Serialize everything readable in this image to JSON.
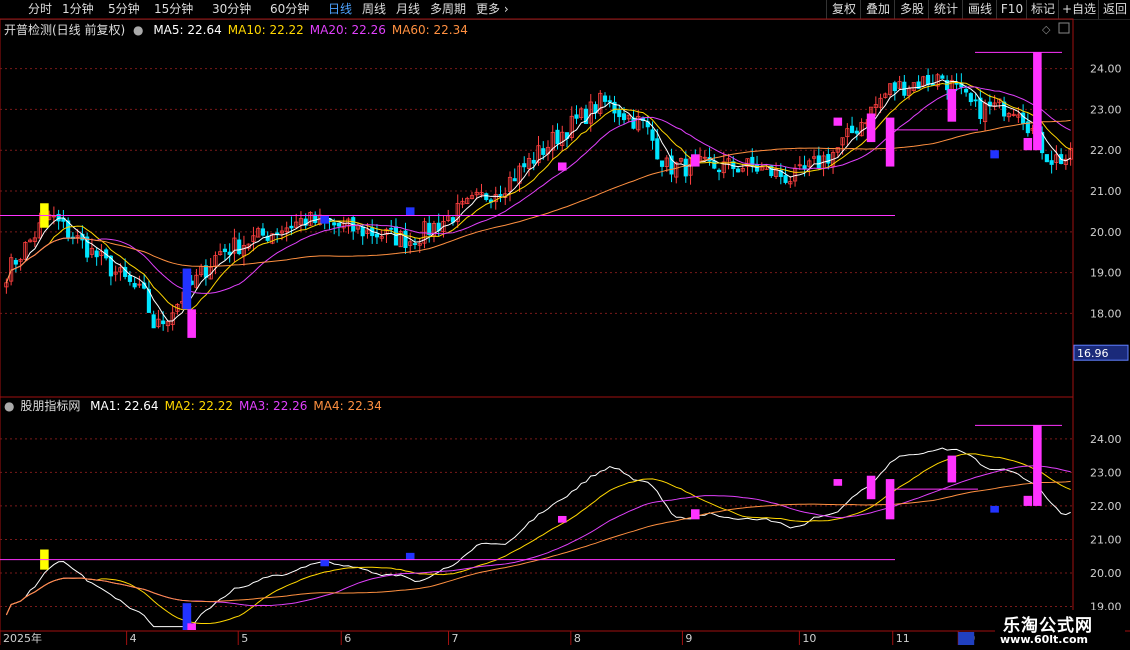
{
  "toolbar": {
    "periods": [
      {
        "label": "分时",
        "active": false
      },
      {
        "label": "1分钟",
        "active": false
      },
      {
        "label": "5分钟",
        "active": false
      },
      {
        "label": "15分钟",
        "active": false
      },
      {
        "label": "30分钟",
        "active": false
      },
      {
        "label": "60分钟",
        "active": false
      },
      {
        "label": "日线",
        "active": true
      },
      {
        "label": "周线",
        "active": false
      },
      {
        "label": "月线",
        "active": false
      },
      {
        "label": "多周期",
        "active": false
      },
      {
        "label": "更多",
        "active": false
      }
    ],
    "right": [
      "复权",
      "叠加",
      "多股",
      "统计",
      "画线",
      "F10",
      "标记",
      "+自选",
      "返回"
    ]
  },
  "main_header": {
    "title": "开普检测(日线 前复权)",
    "ma": [
      {
        "label": "MA5: 22.64",
        "color": "#ffffff"
      },
      {
        "label": "MA10: 22.22",
        "color": "#ffd700"
      },
      {
        "label": "MA20: 22.26",
        "color": "#e040fb"
      },
      {
        "label": "MA60: 22.34",
        "color": "#ff9040"
      }
    ]
  },
  "sub_header": {
    "title": "股朋指标网",
    "ma": [
      {
        "label": "MA1: 22.64",
        "color": "#ffffff"
      },
      {
        "label": "MA2: 22.22",
        "color": "#ffd700"
      },
      {
        "label": "MA3: 22.26",
        "color": "#e040fb"
      },
      {
        "label": "MA4: 22.34",
        "color": "#ff9040"
      }
    ]
  },
  "price_tag": "16.96",
  "colors": {
    "up": "#ff4040",
    "down": "#00e5ff",
    "magenta": "#ff33ff",
    "yellow": "#ffff00",
    "blue": "#2233ff",
    "grid": "#7a1a1a"
  },
  "x_axis": {
    "labels": [
      {
        "label": "2025年",
        "pos": 0.0
      },
      {
        "label": "4",
        "pos": 0.118
      },
      {
        "label": "5",
        "pos": 0.222
      },
      {
        "label": "6",
        "pos": 0.318
      },
      {
        "label": "7",
        "pos": 0.418
      },
      {
        "label": "8",
        "pos": 0.532
      },
      {
        "label": "9",
        "pos": 0.636
      },
      {
        "label": "10",
        "pos": 0.745
      },
      {
        "label": "11",
        "pos": 0.832
      },
      {
        "label": "20",
        "pos": 0.893
      }
    ]
  },
  "watermark": {
    "name": "乐淘公式网",
    "url": "www.60lt.com"
  },
  "chart_data": [
    {
      "type": "candlestick",
      "name": "main",
      "y_ticks": [
        18.0,
        19.0,
        20.0,
        21.0,
        22.0,
        23.0,
        24.0
      ],
      "ylim": [
        16.0,
        24.8
      ],
      "series": [
        "MA5",
        "MA10",
        "MA20",
        "MA60"
      ],
      "price_range_note": "18.0-24.4",
      "horizontal_levels": [
        20.4,
        24.4,
        22.5
      ],
      "ohlc_keypoints": [
        {
          "x": 0.0,
          "close": 19.0
        },
        {
          "x": 0.04,
          "close": 20.4
        },
        {
          "x": 0.13,
          "close": 18.4
        },
        {
          "x": 0.14,
          "close": 17.6
        },
        {
          "x": 0.2,
          "close": 19.5
        },
        {
          "x": 0.28,
          "close": 20.3
        },
        {
          "x": 0.38,
          "close": 19.8
        },
        {
          "x": 0.47,
          "close": 21.2
        },
        {
          "x": 0.52,
          "close": 22.4
        },
        {
          "x": 0.56,
          "close": 23.2
        },
        {
          "x": 0.6,
          "close": 22.6
        },
        {
          "x": 0.62,
          "close": 21.6
        },
        {
          "x": 0.7,
          "close": 21.6
        },
        {
          "x": 0.74,
          "close": 21.3
        },
        {
          "x": 0.78,
          "close": 22.0
        },
        {
          "x": 0.83,
          "close": 23.5
        },
        {
          "x": 0.88,
          "close": 23.8
        },
        {
          "x": 0.91,
          "close": 23.0
        },
        {
          "x": 0.95,
          "close": 23.1
        },
        {
          "x": 0.98,
          "close": 21.8
        }
      ]
    },
    {
      "type": "indicator",
      "name": "sub",
      "y_ticks": [
        19.0,
        20.0,
        21.0,
        22.0,
        23.0,
        24.0
      ],
      "ylim": [
        18.3,
        24.8
      ],
      "series": [
        "MA1",
        "MA2",
        "MA3",
        "MA4"
      ],
      "horizontal_levels": [
        20.4,
        24.4,
        22.5
      ]
    }
  ]
}
